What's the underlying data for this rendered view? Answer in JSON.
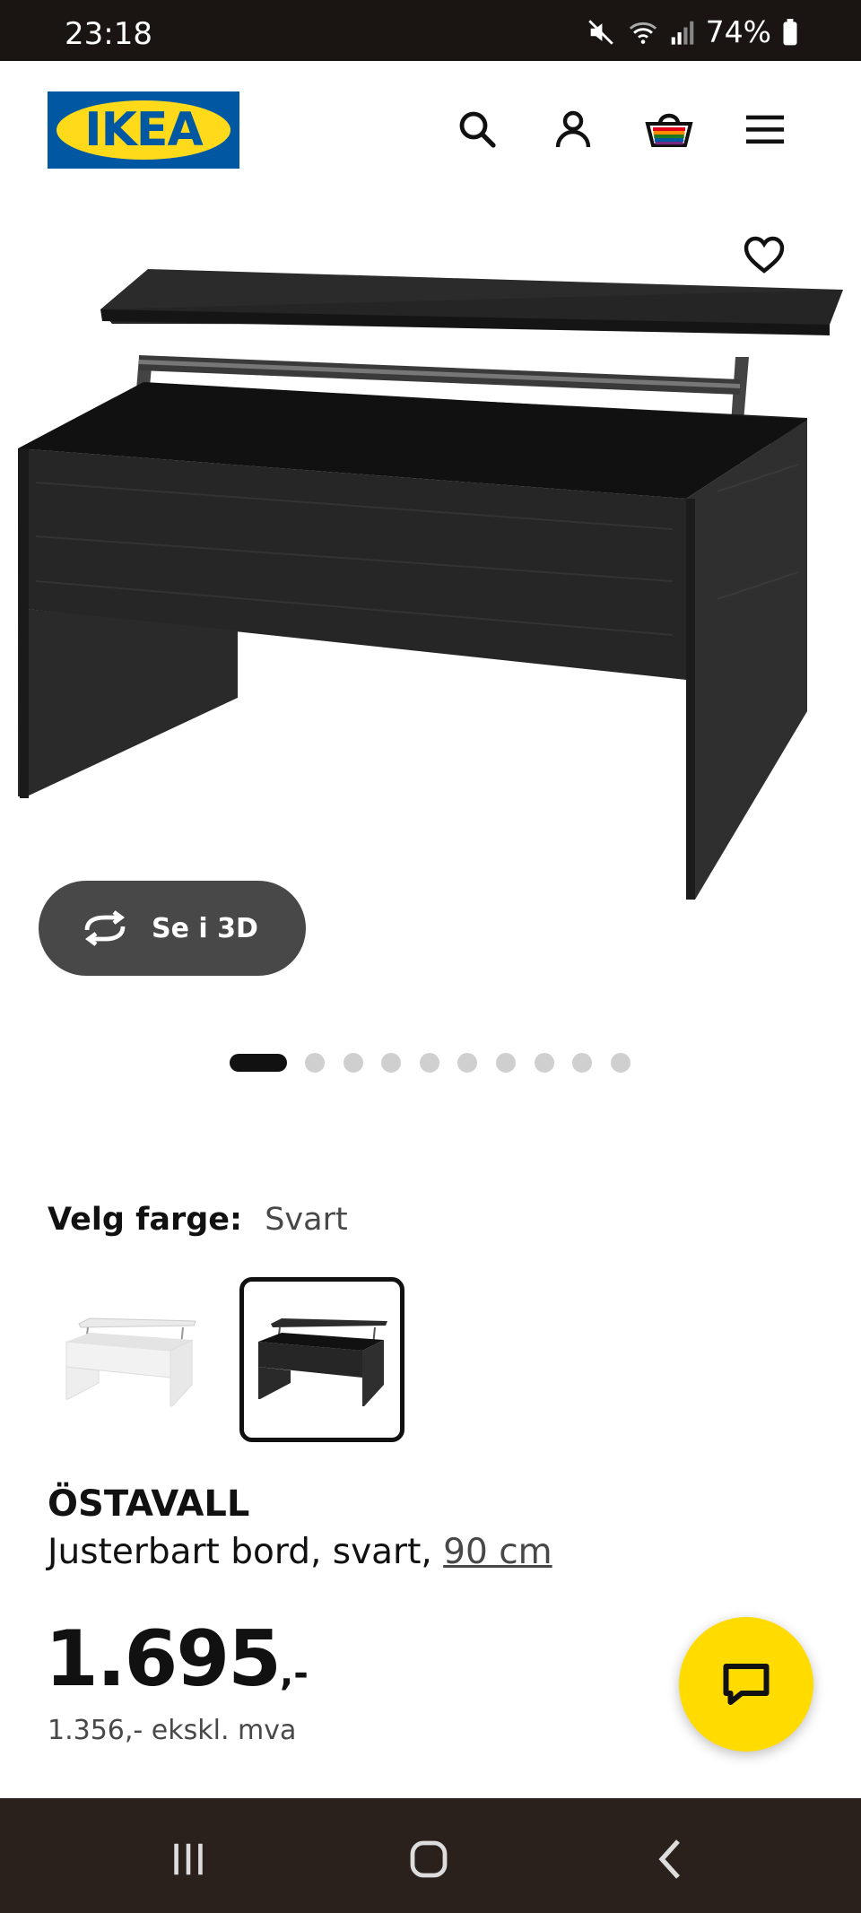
{
  "status_bar": {
    "time": "23:18",
    "battery": "74%",
    "icons": [
      "mute-icon",
      "wifi-icon",
      "signal-icon",
      "battery-icon"
    ]
  },
  "header": {
    "logo_text": "IKEA",
    "icons": [
      "search-icon",
      "account-icon",
      "basket-icon",
      "menu-icon"
    ],
    "brand_blue": "#0058a3",
    "brand_yellow": "#ffda1a"
  },
  "gallery": {
    "view_3d_label": "Se i 3D",
    "slide_count": 10,
    "active_slide": 1
  },
  "color_select": {
    "label": "Velg farge:",
    "value": "Svart",
    "options": [
      "white",
      "black"
    ],
    "selected_index": 1
  },
  "product": {
    "name": "ÖSTAVALL",
    "description": "Justerbart bord, svart, ",
    "size_link": "90 cm",
    "price": "1.695",
    "price_suffix": ",-",
    "price_ex_vat": "1.356,- ekskl. mva"
  },
  "chat": {
    "icon": "chat-icon",
    "color": "#ffdb00"
  },
  "nav_bar": {
    "buttons": [
      "recent-apps-icon",
      "home-icon",
      "back-icon"
    ]
  }
}
